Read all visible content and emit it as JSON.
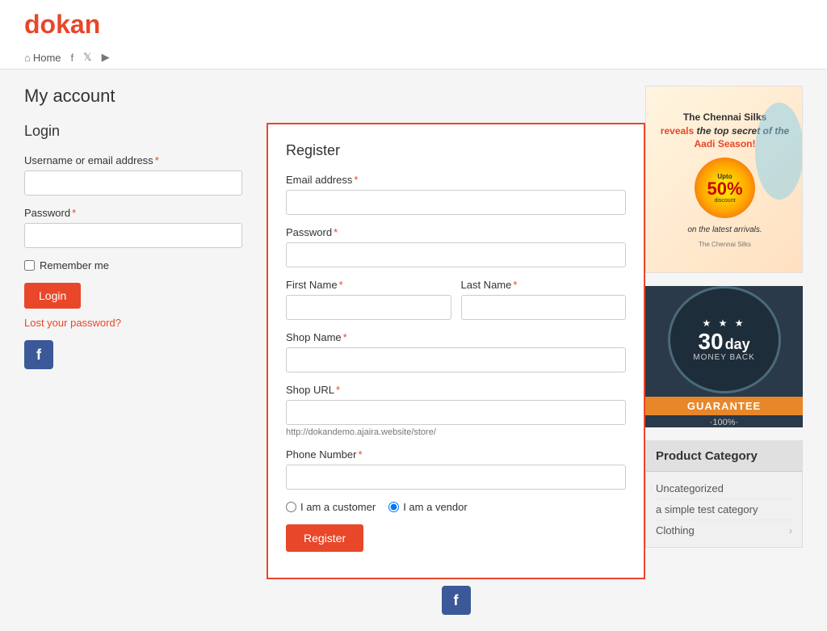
{
  "header": {
    "logo": {
      "d": "d",
      "rest": "okan"
    },
    "nav": {
      "home": "Home",
      "facebook_aria": "Facebook",
      "twitter_aria": "Twitter",
      "youtube_aria": "YouTube"
    }
  },
  "page": {
    "title": "My account"
  },
  "login": {
    "section_title": "Login",
    "username_label": "Username or email address",
    "password_label": "Password",
    "remember_me": "Remember me",
    "login_button": "Login",
    "lost_password": "Lost your password?"
  },
  "register": {
    "section_title": "Register",
    "email_label": "Email address",
    "password_label": "Password",
    "first_name_label": "First Name",
    "last_name_label": "Last Name",
    "shop_name_label": "Shop Name",
    "shop_url_label": "Shop URL",
    "shop_url_hint": "http://dokandemo.ajaira.website/store/",
    "phone_label": "Phone Number",
    "customer_option": "I am a customer",
    "vendor_option": "I am a vendor",
    "register_button": "Register"
  },
  "sidebar": {
    "ad_top_line": "The Chennai Silks",
    "ad_reveals": "reveals",
    "ad_top_secret": "the top secret of the",
    "ad_aadi": "Aadi Season!",
    "ad_discount": "50%",
    "ad_discount_label": "discount on the",
    "ad_arrivals": "latest arrivals.",
    "guarantee_30": "30",
    "guarantee_day": "day",
    "guarantee_money": "MONEY BACK",
    "guarantee_title": "GUARANTEE",
    "guarantee_100": "·100%·",
    "product_category": {
      "title": "Product Category",
      "items": [
        {
          "label": "Uncategorized",
          "has_arrow": false
        },
        {
          "label": "a simple test category",
          "has_arrow": false
        },
        {
          "label": "Clothing",
          "has_arrow": true
        }
      ]
    }
  }
}
